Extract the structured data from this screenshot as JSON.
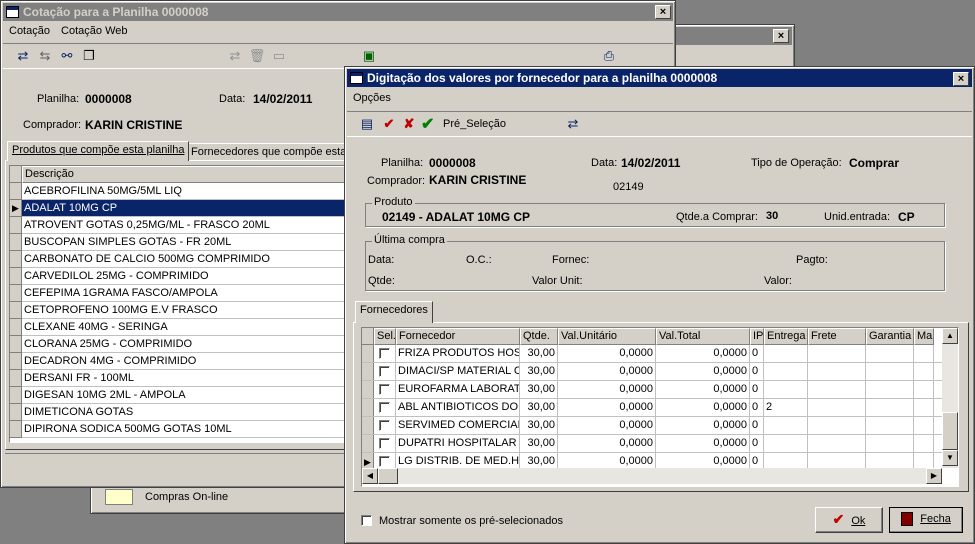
{
  "bg_window": {
    "close": "×",
    "compras_online": "Compras On-line"
  },
  "cotacao_window": {
    "title": "Cotação para a Planilha 0000008",
    "close": "×",
    "menu": [
      "Cotação",
      "Cotação Web"
    ],
    "planilha_label": "Planilha:",
    "planilha_value": "0000008",
    "data_label": "Data:",
    "data_value": "14/02/2011",
    "comprador_label": "Comprador:",
    "comprador_value": "KARIN CRISTINE",
    "tabs": [
      "Produtos que compõe esta planilha",
      "Fornecedores que compõe esta"
    ],
    "grid_header": "Descrição",
    "products": [
      "ACEBROFILINA 50MG/5ML LIQ",
      "ADALAT 10MG CP",
      "ATROVENT GOTAS 0,25MG/ML - FRASCO 20ML",
      "BUSCOPAN SIMPLES GOTAS - FR 20ML",
      "CARBONATO DE CALCIO 500MG COMPRIMIDO",
      "CARVEDILOL 25MG - COMPRIMIDO",
      "CEFEPIMA 1GRAMA FASCO/AMPOLA",
      "CETOPROFENO 100MG E.V FRASCO",
      "CLEXANE 40MG - SERINGA",
      "CLORANA 25MG - COMPRIMIDO",
      "DECADRON 4MG - COMPRIMIDO",
      "DERSANI FR - 100ML",
      "DIGESAN 10MG 2ML - AMPOLA",
      "DIMETICONA GOTAS",
      "DIPIRONA SODICA 500MG GOTAS 10ML"
    ],
    "selected_product": 1
  },
  "digit_window": {
    "title": "Digitação dos valores por fornecedor para a planilha 0000008",
    "close": "×",
    "menu": "Opções",
    "toolbar_pre_selecao": "Pré_Seleção",
    "planilha_label": "Planilha:",
    "planilha_value": "0000008",
    "data_label": "Data:",
    "data_value": "14/02/2011",
    "tipo_label": "Tipo de Operação:",
    "tipo_value": "Comprar",
    "comprador_label": "Comprador:",
    "comprador_value": "KARIN CRISTINE",
    "code_value": "02149",
    "produto_group": "Produto",
    "produto_value": "02149 - ADALAT 10MG CP",
    "qtde_comprar_label": "Qtde.a Comprar:",
    "qtde_comprar_value": "30",
    "unid_label": "Unid.entrada:",
    "unid_value": "CP",
    "ultima_group": "Última compra",
    "uc_data": "Data:",
    "uc_oc": "O.C.:",
    "uc_fornec": "Fornec:",
    "uc_pagto": "Pagto:",
    "uc_qtde": "Qtde:",
    "uc_valor_unit": "Valor Unit:",
    "uc_valor": "Valor:",
    "tab_fornecedores": "Fornecedores",
    "grid_headers": [
      "Sel.",
      "Fornecedor",
      "Qtde.",
      "Val.Unitário",
      "Val.Total",
      "IPI",
      "Entrega",
      "Frete",
      "Garantia",
      "Ma"
    ],
    "suppliers": [
      {
        "name": "FRIZA PRODUTOS HOS",
        "qtde": "30,00",
        "unit": "0,0000",
        "total": "0,0000",
        "ipi": "0",
        "entrega": ""
      },
      {
        "name": "DIMACI/SP MATERIAL C",
        "qtde": "30,00",
        "unit": "0,0000",
        "total": "0,0000",
        "ipi": "0",
        "entrega": ""
      },
      {
        "name": "EUROFARMA LABORAT",
        "qtde": "30,00",
        "unit": "0,0000",
        "total": "0,0000",
        "ipi": "0",
        "entrega": ""
      },
      {
        "name": "ABL ANTIBIOTICOS DO",
        "qtde": "30,00",
        "unit": "0,0000",
        "total": "0,0000",
        "ipi": "0",
        "entrega": "2"
      },
      {
        "name": "SERVIMED COMERCIAL",
        "qtde": "30,00",
        "unit": "0,0000",
        "total": "0,0000",
        "ipi": "0",
        "entrega": ""
      },
      {
        "name": "DUPATRI HOSPITALAR",
        "qtde": "30,00",
        "unit": "0,0000",
        "total": "0,0000",
        "ipi": "0",
        "entrega": ""
      },
      {
        "name": "LG DISTRIB. DE MED.H",
        "qtde": "30,00",
        "unit": "0,0000",
        "total": "0,0000",
        "ipi": "0",
        "entrega": ""
      }
    ],
    "current_row": 6,
    "mostrar_label": "Mostrar somente os pré-selecionados",
    "ok_label": "Ok",
    "fecha_label": "Fecha"
  },
  "colors": {
    "title_active": "#0a246a",
    "title_inactive": "#808080",
    "face": "#d4d0c8"
  }
}
